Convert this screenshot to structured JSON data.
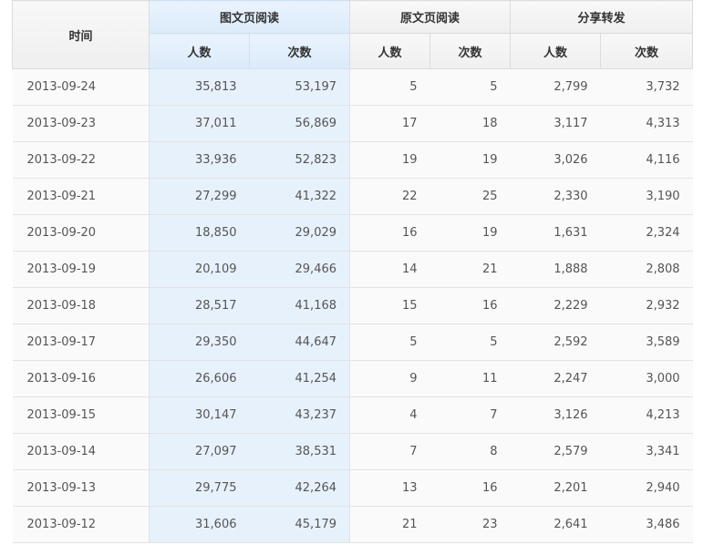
{
  "header": {
    "time": "时间",
    "groups": [
      {
        "label": "图文页阅读"
      },
      {
        "label": "原文页阅读"
      },
      {
        "label": "分享转发"
      }
    ],
    "sub": [
      "人数",
      "次数",
      "人数",
      "次数",
      "人数",
      "次数"
    ]
  },
  "rows": [
    {
      "date": "2013-09-24",
      "tw_people": "35,813",
      "tw_times": "53,197",
      "yw_people": "5",
      "yw_times": "5",
      "fx_people": "2,799",
      "fx_times": "3,732"
    },
    {
      "date": "2013-09-23",
      "tw_people": "37,011",
      "tw_times": "56,869",
      "yw_people": "17",
      "yw_times": "18",
      "fx_people": "3,117",
      "fx_times": "4,313"
    },
    {
      "date": "2013-09-22",
      "tw_people": "33,936",
      "tw_times": "52,823",
      "yw_people": "19",
      "yw_times": "19",
      "fx_people": "3,026",
      "fx_times": "4,116"
    },
    {
      "date": "2013-09-21",
      "tw_people": "27,299",
      "tw_times": "41,322",
      "yw_people": "22",
      "yw_times": "25",
      "fx_people": "2,330",
      "fx_times": "3,190"
    },
    {
      "date": "2013-09-20",
      "tw_people": "18,850",
      "tw_times": "29,029",
      "yw_people": "16",
      "yw_times": "19",
      "fx_people": "1,631",
      "fx_times": "2,324"
    },
    {
      "date": "2013-09-19",
      "tw_people": "20,109",
      "tw_times": "29,466",
      "yw_people": "14",
      "yw_times": "21",
      "fx_people": "1,888",
      "fx_times": "2,808"
    },
    {
      "date": "2013-09-18",
      "tw_people": "28,517",
      "tw_times": "41,168",
      "yw_people": "15",
      "yw_times": "16",
      "fx_people": "2,229",
      "fx_times": "2,932"
    },
    {
      "date": "2013-09-17",
      "tw_people": "29,350",
      "tw_times": "44,647",
      "yw_people": "5",
      "yw_times": "5",
      "fx_people": "2,592",
      "fx_times": "3,589"
    },
    {
      "date": "2013-09-16",
      "tw_people": "26,606",
      "tw_times": "41,254",
      "yw_people": "9",
      "yw_times": "11",
      "fx_people": "2,247",
      "fx_times": "3,000"
    },
    {
      "date": "2013-09-15",
      "tw_people": "30,147",
      "tw_times": "43,237",
      "yw_people": "4",
      "yw_times": "7",
      "fx_people": "3,126",
      "fx_times": "4,213"
    },
    {
      "date": "2013-09-14",
      "tw_people": "27,097",
      "tw_times": "38,531",
      "yw_people": "7",
      "yw_times": "8",
      "fx_people": "2,579",
      "fx_times": "3,341"
    },
    {
      "date": "2013-09-13",
      "tw_people": "29,775",
      "tw_times": "42,264",
      "yw_people": "13",
      "yw_times": "16",
      "fx_people": "2,201",
      "fx_times": "2,940"
    },
    {
      "date": "2013-09-12",
      "tw_people": "31,606",
      "tw_times": "45,179",
      "yw_people": "21",
      "yw_times": "23",
      "fx_people": "2,641",
      "fx_times": "3,486"
    }
  ]
}
